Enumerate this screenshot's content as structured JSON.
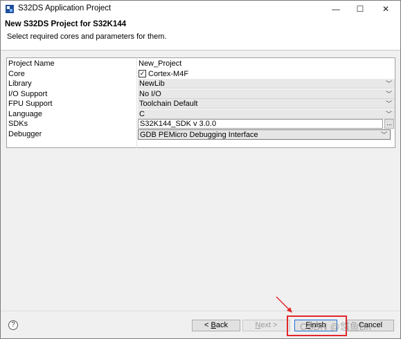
{
  "window": {
    "title": "S32DS Application Project",
    "controls": {
      "minimize": "—",
      "maximize": "☐",
      "close": "✕"
    }
  },
  "header": {
    "title": "New S32DS Project for S32K144",
    "description": "Select required cores and parameters for them."
  },
  "properties": [
    {
      "name": "Project Name",
      "value": "New_Project",
      "kind": "text"
    },
    {
      "name": "Core",
      "value": "Cortex-M4F",
      "kind": "checkbox",
      "checked": true
    },
    {
      "name": "Library",
      "value": "NewLib",
      "kind": "combo"
    },
    {
      "name": "I/O Support",
      "value": "No I/O",
      "kind": "combo"
    },
    {
      "name": "FPU Support",
      "value": "Toolchain Default",
      "kind": "combo"
    },
    {
      "name": "Language",
      "value": "C",
      "kind": "combo"
    },
    {
      "name": "SDKs",
      "value": "S32K144_SDK v 3.0.0",
      "kind": "browse",
      "browse_label": "..."
    },
    {
      "name": "Debugger",
      "value": "GDB PEMicro Debugging Interface",
      "kind": "combo-active"
    }
  ],
  "footer": {
    "help": "?",
    "back_prefix": "< ",
    "back_label_u": "B",
    "back_label_rest": "ack",
    "next_label_u": "N",
    "next_label_rest": "ext >",
    "finish_label_u": "F",
    "finish_label_rest": "inish",
    "cancel_label": "Cancel"
  },
  "watermark": "CSDN @悠鱼Bh",
  "colors": {
    "annotation": "#e3262a",
    "default_button_border": "#1d70d4"
  }
}
